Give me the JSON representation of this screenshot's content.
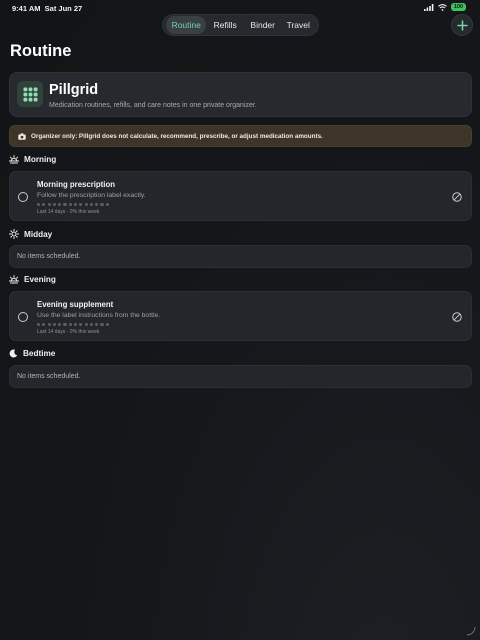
{
  "status": {
    "time": "9:41 AM",
    "date": "Sat Jun 27",
    "battery": "100"
  },
  "nav": {
    "tabs": [
      {
        "label": "Routine",
        "active": true
      },
      {
        "label": "Refills",
        "active": false
      },
      {
        "label": "Binder",
        "active": false
      },
      {
        "label": "Travel",
        "active": false
      }
    ],
    "add_icon": "plus-icon"
  },
  "page_title": "Routine",
  "hero": {
    "app_name": "Pillgrid",
    "subtitle": "Medication routines, refills, and care notes in one private organizer.",
    "icon": "grid-icon"
  },
  "notice": {
    "text": "Organizer only: Pillgrid does not calculate, recommend, prescribe, or adjust medication amounts.",
    "icon": "camera-icon"
  },
  "sections": {
    "morning": {
      "label": "Morning",
      "icon": "sunrise-icon",
      "item": {
        "title": "Morning prescription",
        "note": "Follow the prescription label exactly.",
        "stats": "Last 14 days · 0% this week",
        "days_tracked": 14
      }
    },
    "midday": {
      "label": "Midday",
      "icon": "sun-icon",
      "empty": "No items scheduled."
    },
    "evening": {
      "label": "Evening",
      "icon": "sunset-icon",
      "item": {
        "title": "Evening supplement",
        "note": "Use the label instructions from the bottle.",
        "stats": "Last 14 days · 0% this week",
        "days_tracked": 14
      }
    },
    "bedtime": {
      "label": "Bedtime",
      "icon": "moon-icon",
      "empty": "No items scheduled."
    }
  },
  "colors": {
    "accent": "#74d3a6",
    "card": "#23272b",
    "notice": "#3e3427"
  }
}
